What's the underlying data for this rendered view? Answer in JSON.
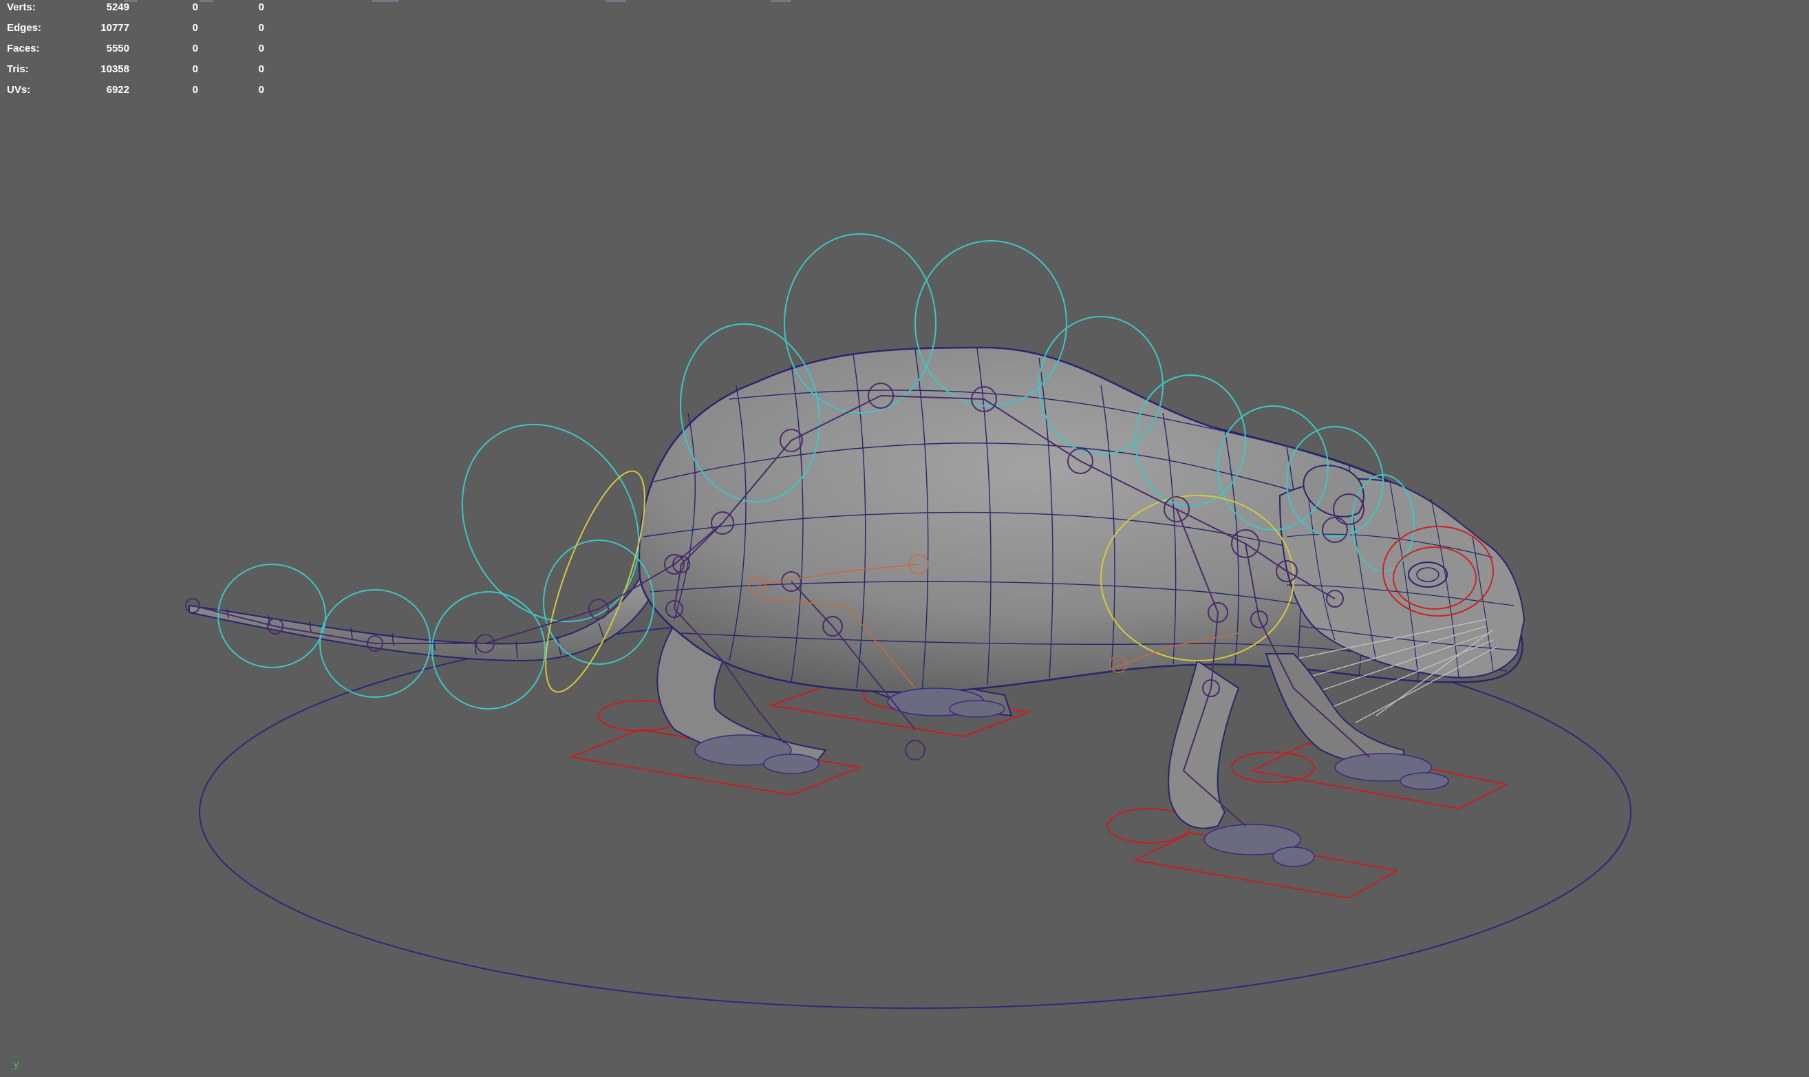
{
  "hud": {
    "rows": [
      {
        "label": "Verts:",
        "values": [
          "5249",
          "0",
          "0"
        ]
      },
      {
        "label": "Edges:",
        "values": [
          "10777",
          "0",
          "0"
        ]
      },
      {
        "label": "Faces:",
        "values": [
          "5550",
          "0",
          "0"
        ]
      },
      {
        "label": "Tris:",
        "values": [
          "10358",
          "0",
          "0"
        ]
      },
      {
        "label": "UVs:",
        "values": [
          "6922",
          "0",
          "0"
        ]
      }
    ]
  },
  "axis_indicator": "y",
  "colors": {
    "viewport_bg": "#5d5d5d",
    "wireframe": "#26266e",
    "mesh_fill": "#8c8c8c",
    "control_cyan": "#3ec6c6",
    "control_red": "#d02020",
    "control_yellow": "#d8c83a",
    "joint_purple": "#5a2a6a",
    "axis_green": "#40d040"
  },
  "scene": {
    "object": "rat-rig",
    "icons": [
      "spine-control-icon",
      "tail-control-icon",
      "foot-control-icon",
      "ground-circle-icon"
    ]
  }
}
